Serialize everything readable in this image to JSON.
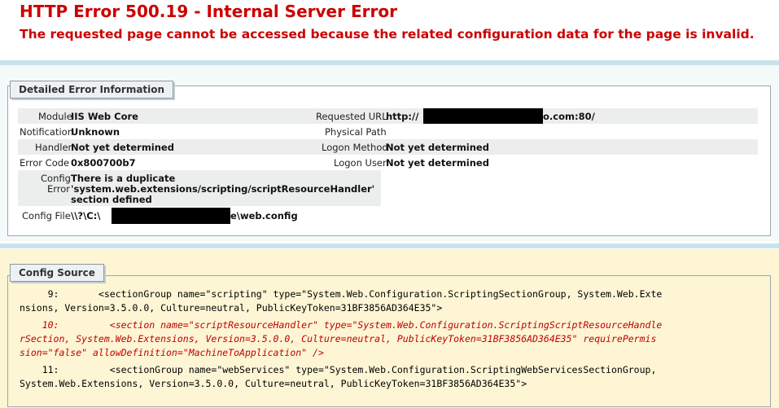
{
  "title": "HTTP Error 500.19 - Internal Server Error",
  "subtitle": "The requested page cannot be accessed because the related configuration data for the page is invalid.",
  "details": {
    "legend": "Detailed Error Information",
    "module_label": "Module",
    "module_value": "IIS Web Core",
    "notification_label": "Notification",
    "notification_value": "Unknown",
    "handler_label": "Handler",
    "handler_value": "Not yet determined",
    "error_code_label": "Error Code",
    "error_code_value": "0x800700b7",
    "config_error_label_1": "Config",
    "config_error_label_2": "Error",
    "config_error_value_1": "There is a duplicate",
    "config_error_value_2": "'system.web.extensions/scripting/scriptResourceHandler'",
    "config_error_value_3": "section defined",
    "config_file_label": "Config File",
    "config_file_prefix": "\\\\?\\C:\\",
    "config_file_suffix": "e\\web.config",
    "requested_url_label": "Requested URL",
    "requested_url_prefix": "http://",
    "requested_url_suffix": "o.com:80/",
    "physical_path_label": "Physical Path",
    "logon_method_label": "Logon Method",
    "logon_method_value": "Not yet determined",
    "logon_user_label": "Logon User",
    "logon_user_value": "Not yet determined"
  },
  "config_source": {
    "legend": "Config Source",
    "lines": [
      "     9:       <sectionGroup name=\"scripting\" type=\"System.Web.Configuration.ScriptingSectionGroup, System.Web.Exte",
      "nsions, Version=3.5.0.0, Culture=neutral, PublicKeyToken=31BF3856AD364E35\">",
      "    10:         <section name=\"scriptResourceHandler\" type=\"System.Web.Configuration.ScriptingScriptResourceHandle",
      "rSection, System.Web.Extensions, Version=3.5.0.0, Culture=neutral, PublicKeyToken=31BF3856AD364E35\" requirePermis",
      "sion=\"false\" allowDefinition=\"MachineToApplication\" />",
      "    11:         <sectionGroup name=\"webServices\" type=\"System.Web.Configuration.ScriptingWebServicesSectionGroup,",
      "System.Web.Extensions, Version=3.5.0.0, Culture=neutral, PublicKeyToken=31BF3856AD364E35\">"
    ]
  }
}
